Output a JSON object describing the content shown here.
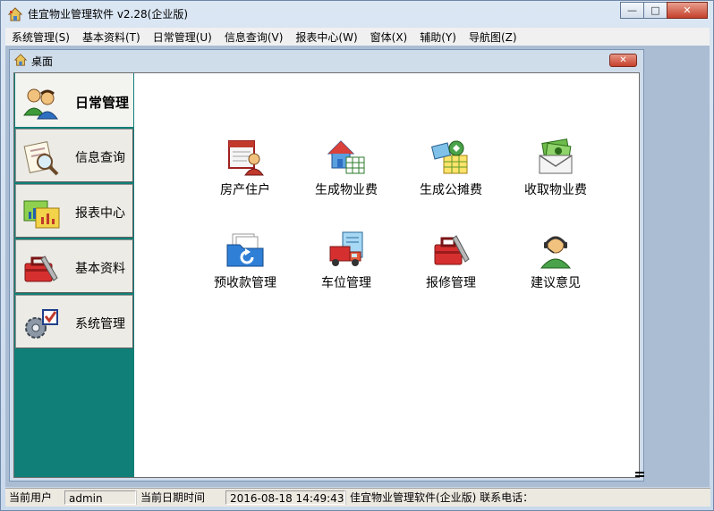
{
  "window": {
    "title": "佳宜物业管理软件 v2.28(企业版)",
    "buttons": {
      "minimize": "—",
      "maximize": "□",
      "close": "✕"
    }
  },
  "menu": [
    "系统管理(S)",
    "基本资料(T)",
    "日常管理(U)",
    "信息查询(V)",
    "报表中心(W)",
    "窗体(X)",
    "辅助(Y)",
    "导航图(Z)"
  ],
  "desktop": {
    "title": "桌面",
    "close": "✕"
  },
  "sidebar": [
    {
      "label": "日常管理",
      "active": true,
      "icon": "users-icon"
    },
    {
      "label": "信息查询",
      "active": false,
      "icon": "search-document-icon"
    },
    {
      "label": "报表中心",
      "active": false,
      "icon": "report-chart-icon"
    },
    {
      "label": "基本资料",
      "active": false,
      "icon": "toolbox-icon"
    },
    {
      "label": "系统管理",
      "active": false,
      "icon": "settings-gear-icon"
    }
  ],
  "functions": [
    {
      "label": "房产住户",
      "icon": "house-resident-icon"
    },
    {
      "label": "生成物业费",
      "icon": "house-spreadsheet-icon"
    },
    {
      "label": "生成公摊费",
      "icon": "shared-fee-icon"
    },
    {
      "label": "收取物业费",
      "icon": "money-envelope-icon"
    },
    {
      "label": "预收款管理",
      "icon": "prepayment-folder-icon"
    },
    {
      "label": "车位管理",
      "icon": "parking-truck-icon"
    },
    {
      "label": "报修管理",
      "icon": "repair-toolbox-icon"
    },
    {
      "label": "建议意见",
      "icon": "support-agent-icon"
    }
  ],
  "status": {
    "user_label": "当前用户",
    "user": "admin",
    "datetime_label": "当前日期时间",
    "datetime": "2016-08-18 14:49:43",
    "info": "佳宜物业管理软件(企业版) 联系电话："
  },
  "colors": {
    "sidebar_bg": "#0f7f77",
    "close_button": "#c5422c",
    "frame": "#cfdcea"
  }
}
